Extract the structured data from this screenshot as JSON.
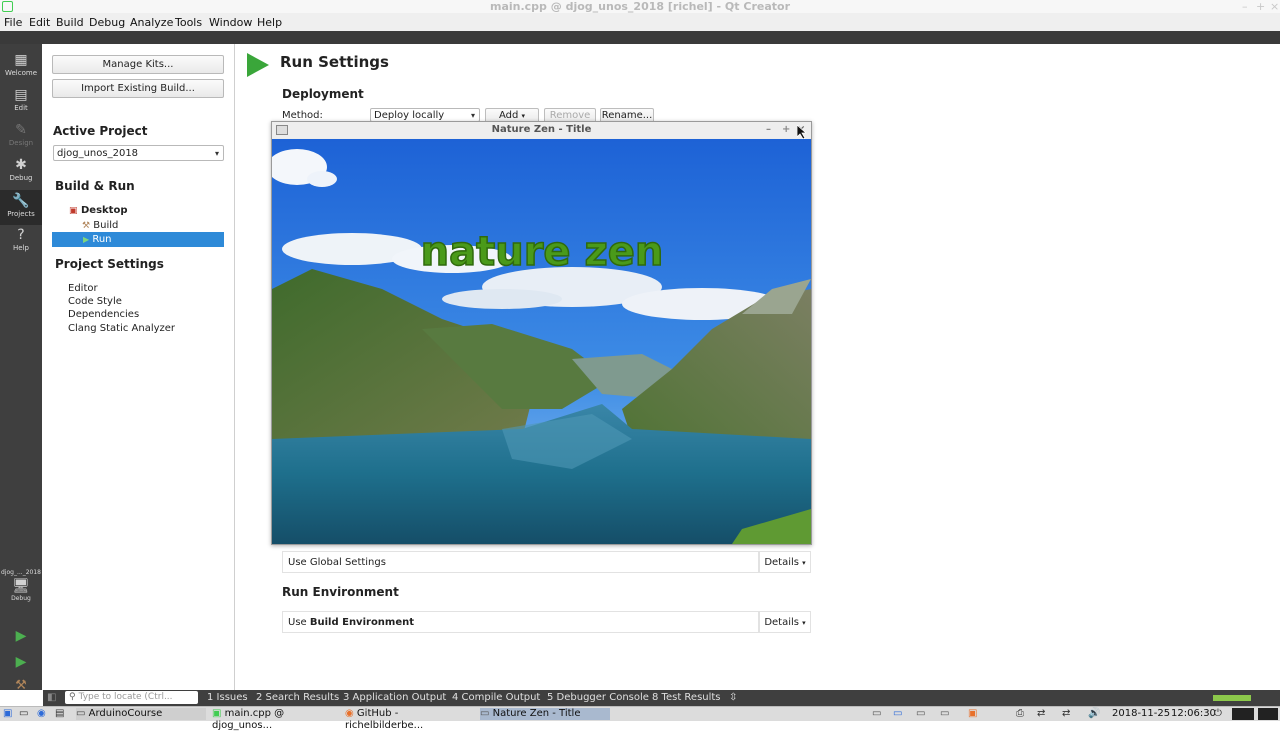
{
  "window": {
    "title": "main.cpp @ djog_unos_2018 [richel] - Qt Creator"
  },
  "menu": [
    "File",
    "Edit",
    "Build",
    "Debug",
    "Analyze",
    "Tools",
    "Window",
    "Help"
  ],
  "modes": {
    "welcome": "Welcome",
    "edit": "Edit",
    "design": "Design",
    "debug": "Debug",
    "projects": "Projects",
    "help": "Help",
    "target": "djog_..._2018",
    "target_mode": "Debug"
  },
  "left": {
    "manage_kits": "Manage Kits...",
    "import_build": "Import Existing Build...",
    "active_project_heading": "Active Project",
    "active_project_value": "djog_unos_2018",
    "build_run_heading": "Build & Run",
    "tree": {
      "desktop": "Desktop",
      "build": "Build",
      "run": "Run"
    },
    "project_settings_heading": "Project Settings",
    "settings": [
      "Editor",
      "Code Style",
      "Dependencies",
      "Clang Static Analyzer"
    ]
  },
  "main": {
    "title": "Run Settings",
    "deployment_heading": "Deployment",
    "method_label": "Method:",
    "method_value": "Deploy locally",
    "add": "Add",
    "remove": "Remove",
    "rename": "Rename...",
    "global_settings": "Use Global Settings",
    "details": "Details",
    "run_env_heading": "Run Environment",
    "use_prefix": "Use",
    "build_environment": "Build Environment"
  },
  "popup": {
    "title": "Nature Zen - Title",
    "banner": "nature zen"
  },
  "bottom": {
    "locate_placeholder": "Type to locate (Ctrl...",
    "tabs": [
      "1  Issues",
      "2  Search Results",
      "3  Application Output",
      "4  Compile Output",
      "5  Debugger Console",
      "8  Test Results"
    ]
  },
  "taskbar": {
    "tasks": [
      "ArduinoCourse",
      "main.cpp @ djog_unos...",
      "GitHub - richelbilderbe...",
      "Nature Zen - Title"
    ],
    "date": "2018-11-25",
    "time": "12:06:30"
  },
  "colors": {
    "accent": "#2e8ad8",
    "play_green": "#3aa63a",
    "banner_green": "#4a9a1a"
  }
}
